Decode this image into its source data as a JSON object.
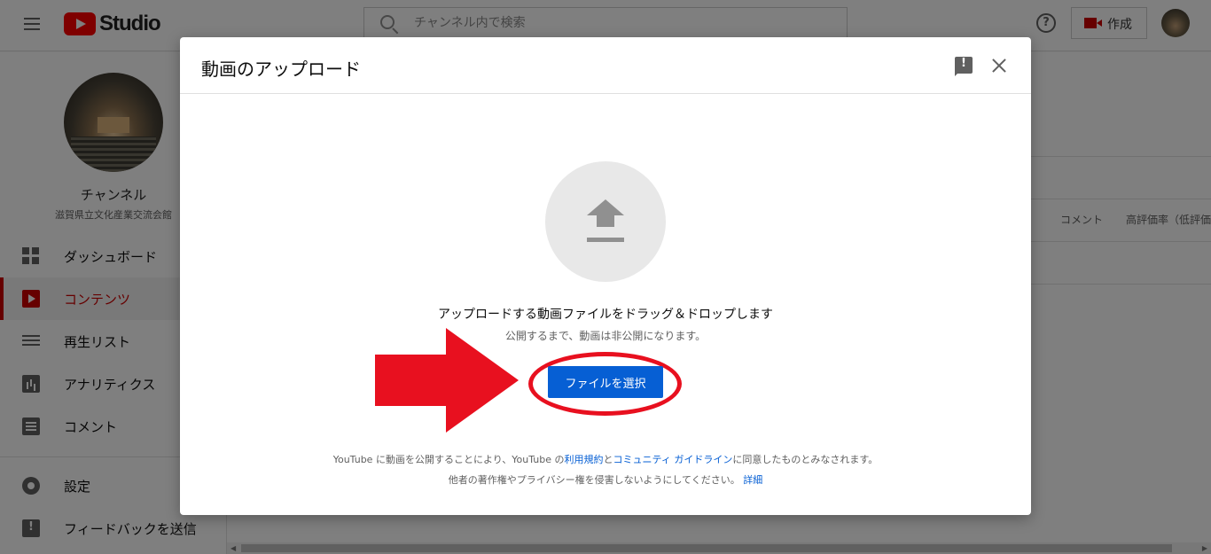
{
  "header": {
    "logo_text": "Studio",
    "search_placeholder": "チャンネル内で検索",
    "help_glyph": "?",
    "create_label": "作成"
  },
  "sidebar": {
    "channel_title": "チャンネル",
    "channel_name": "滋賀県立文化産業交流会館",
    "items": [
      {
        "label": "ダッシュボード",
        "icon": "dashboard-icon"
      },
      {
        "label": "コンテンツ",
        "icon": "content-icon",
        "active": true
      },
      {
        "label": "再生リスト",
        "icon": "playlist-icon"
      },
      {
        "label": "アナリティクス",
        "icon": "analytics-icon"
      },
      {
        "label": "コメント",
        "icon": "comment-icon"
      },
      {
        "label": "設定",
        "icon": "gear-icon"
      },
      {
        "label": "フィードバックを送信",
        "icon": "feedback-icon"
      }
    ]
  },
  "main": {
    "columns": [
      "コメント",
      "高評価率（低評価"
    ]
  },
  "dialog": {
    "title": "動画のアップロード",
    "drag_text": "アップロードする動画ファイルをドラッグ＆ドロップします",
    "sub_text": "公開するまで、動画は非公開になります。",
    "select_button": "ファイルを選択",
    "terms_prefix": "YouTube に動画を公開することにより、YouTube の",
    "terms_link1": "利用規約",
    "terms_and": "と",
    "terms_link2": "コミュニティ ガイドライン",
    "terms_suffix": "に同意したものとみなされます。",
    "rights_text": "他者の著作権やプライバシー権を侵害しないようにしてください。",
    "details_link": "詳細"
  },
  "colors": {
    "accent": "#065fd4",
    "brand_red": "#cc0000",
    "annotation_red": "#e8101f"
  }
}
